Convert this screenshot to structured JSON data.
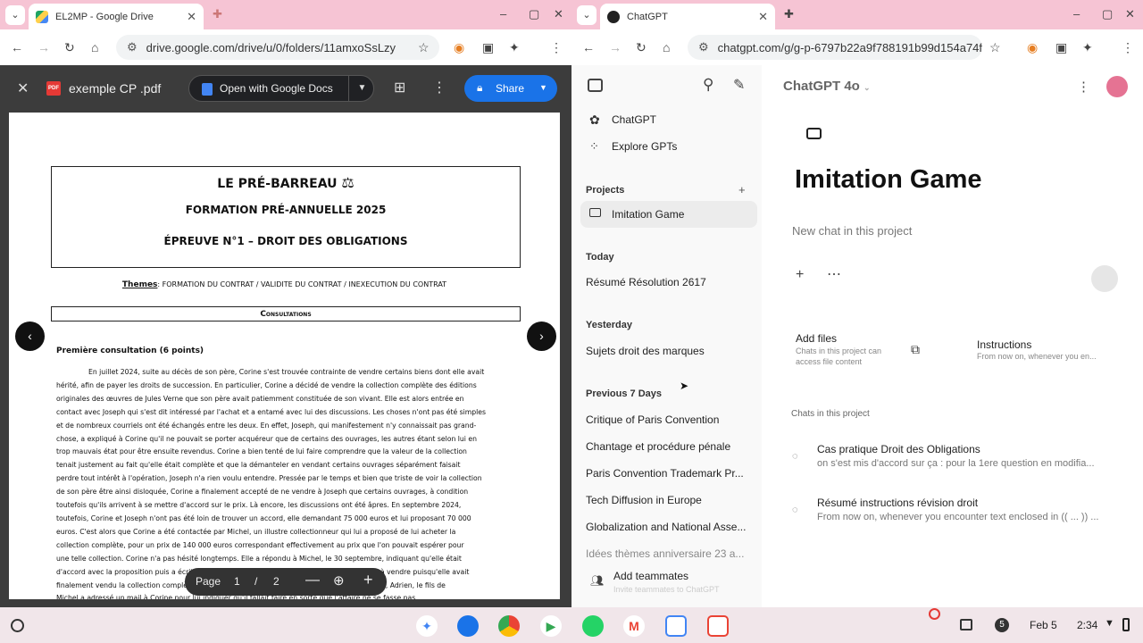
{
  "left_window": {
    "tab_title": "EL2MP - Google Drive",
    "url": "drive.google.com/drive/u/0/folders/11amxoSsLzy",
    "viewer": {
      "file_name": "exemple CP .pdf",
      "open_with_label": "Open with Google Docs",
      "share_label": "Share",
      "page_label": "Page",
      "page_current": "1",
      "page_sep": "/",
      "page_total": "2"
    },
    "doc": {
      "title": "LE PRÉ-BARREAU",
      "subtitle": "FORMATION PRÉ-ANNUELLE 2025",
      "exam": "ÉPREUVE N°1 – DROIT DES OBLIGATIONS",
      "themes_label": "Themes",
      "themes_text": ": formation du contrat / validite du contrat / inexecution du contrat",
      "section": "Consultations",
      "consult_title": "Première consultation (6 points)",
      "lines": [
        "En juillet 2024, suite au décès de son père, Corine s'est trouvée contrainte de vendre certains biens dont elle avait",
        "hérité, afin de payer les droits de succession. En particulier, Corine a décidé de vendre la collection complète des éditions",
        "originales des œuvres de Jules Verne que son père avait patiemment constituée de son vivant. Elle est alors entrée en",
        "contact avec Joseph qui s'est dit intéressé par l'achat et a entamé avec lui des discussions. Les choses n'ont pas été simples",
        "et de nombreux courriels ont été échangés entre les deux. En effet, Joseph, qui manifestement n'y connaissait pas grand-",
        "chose, a expliqué à Corine qu'il ne pouvait se porter acquéreur que de certains des ouvrages, les autres étant selon lui en",
        "trop mauvais état pour être ensuite revendus. Corine a bien tenté de lui faire comprendre que la valeur de la collection",
        "tenait justement au fait qu'elle était complète et que la démanteler en vendant certains ouvrages séparément faisait",
        "perdre tout intérêt à l'opération, Joseph n'a rien voulu entendre. Pressée par le temps et bien que triste de voir la collection",
        "de son père être ainsi disloquée, Corine a finalement accepté de ne vendre à Joseph que certains ouvrages, à condition",
        "toutefois qu'ils arrivent à se mettre d'accord sur le prix. Là encore, les discussions ont été âpres. En septembre 2024,",
        "toutefois, Corine et Joseph n'ont pas été loin de trouver un accord, elle demandant 75 000 euros et lui proposant 70 000",
        "euros. C'est alors que Corine a été contactée par Michel, un illustre collectionneur qui lui a proposé de lui acheter la",
        "collection complète, pour un prix de 140 000 euros correspondant effectivement au prix que l'on pouvait espérer pour",
        "une telle collection. Corine n'a pas hésité longtemps. Elle a répondu à Michel, le 30 septembre, indiquant qu'elle était",
        "d'accord avec la proposition puis a écrit à Joseph pour lui dire que les ouvrages n'étaient plus à vendre puisqu'elle avait",
        "finalement vendu la collection complète à un autre acquéreur. Joseph a alors écrit. Le 8 octobre, Adrien, le fils de",
        "Michel a adressé un mail à Corine pour lui indiquer qu'il fallait faire en sorte que l'affaire ne se fasse pas."
      ]
    }
  },
  "right_window": {
    "tab_title": "ChatGPT",
    "url": "chatgpt.com/g/g-p-6797b22a9f788191b99d154a74f6f...",
    "model_label": "ChatGPT 4o",
    "sidebar": {
      "items": [
        "ChatGPT",
        "Explore GPTs"
      ],
      "projects_label": "Projects",
      "project_active": "Imitation Game",
      "sections": [
        {
          "label": "Today",
          "chats": [
            "Résumé Résolution 2617"
          ]
        },
        {
          "label": "Yesterday",
          "chats": [
            "Sujets droit des marques"
          ]
        },
        {
          "label": "Previous 7 Days",
          "chats": [
            "Critique of Paris Convention",
            "Chantage et procédure pénale",
            "Paris Convention Trademark Pr...",
            "Tech Diffusion in Europe",
            "Globalization and National Asse...",
            "Idées thèmes anniversaire 23 a..."
          ]
        }
      ],
      "add_teammates": "Add teammates",
      "add_teammates_sub": "Invite teammates to ChatGPT"
    },
    "project": {
      "title": "Imitation Game",
      "input_placeholder": "New chat in this project",
      "add_files_title": "Add files",
      "add_files_desc": "Chats in this project can access file content",
      "instructions_title": "Instructions",
      "instructions_desc": "From now on, whenever you en...",
      "chats_header": "Chats in this project",
      "chats": [
        {
          "title": "Cas pratique Droit des Obligations",
          "preview": "on s'est mis d'accord sur ça : pour la 1ere question en modifia..."
        },
        {
          "title": "Résumé instructions révision droit",
          "preview": "From now on, whenever you encounter text enclosed in (( ... )) ..."
        }
      ]
    }
  },
  "shelf": {
    "time": "2:34",
    "date": "Feb 5",
    "notif_count": "5"
  }
}
